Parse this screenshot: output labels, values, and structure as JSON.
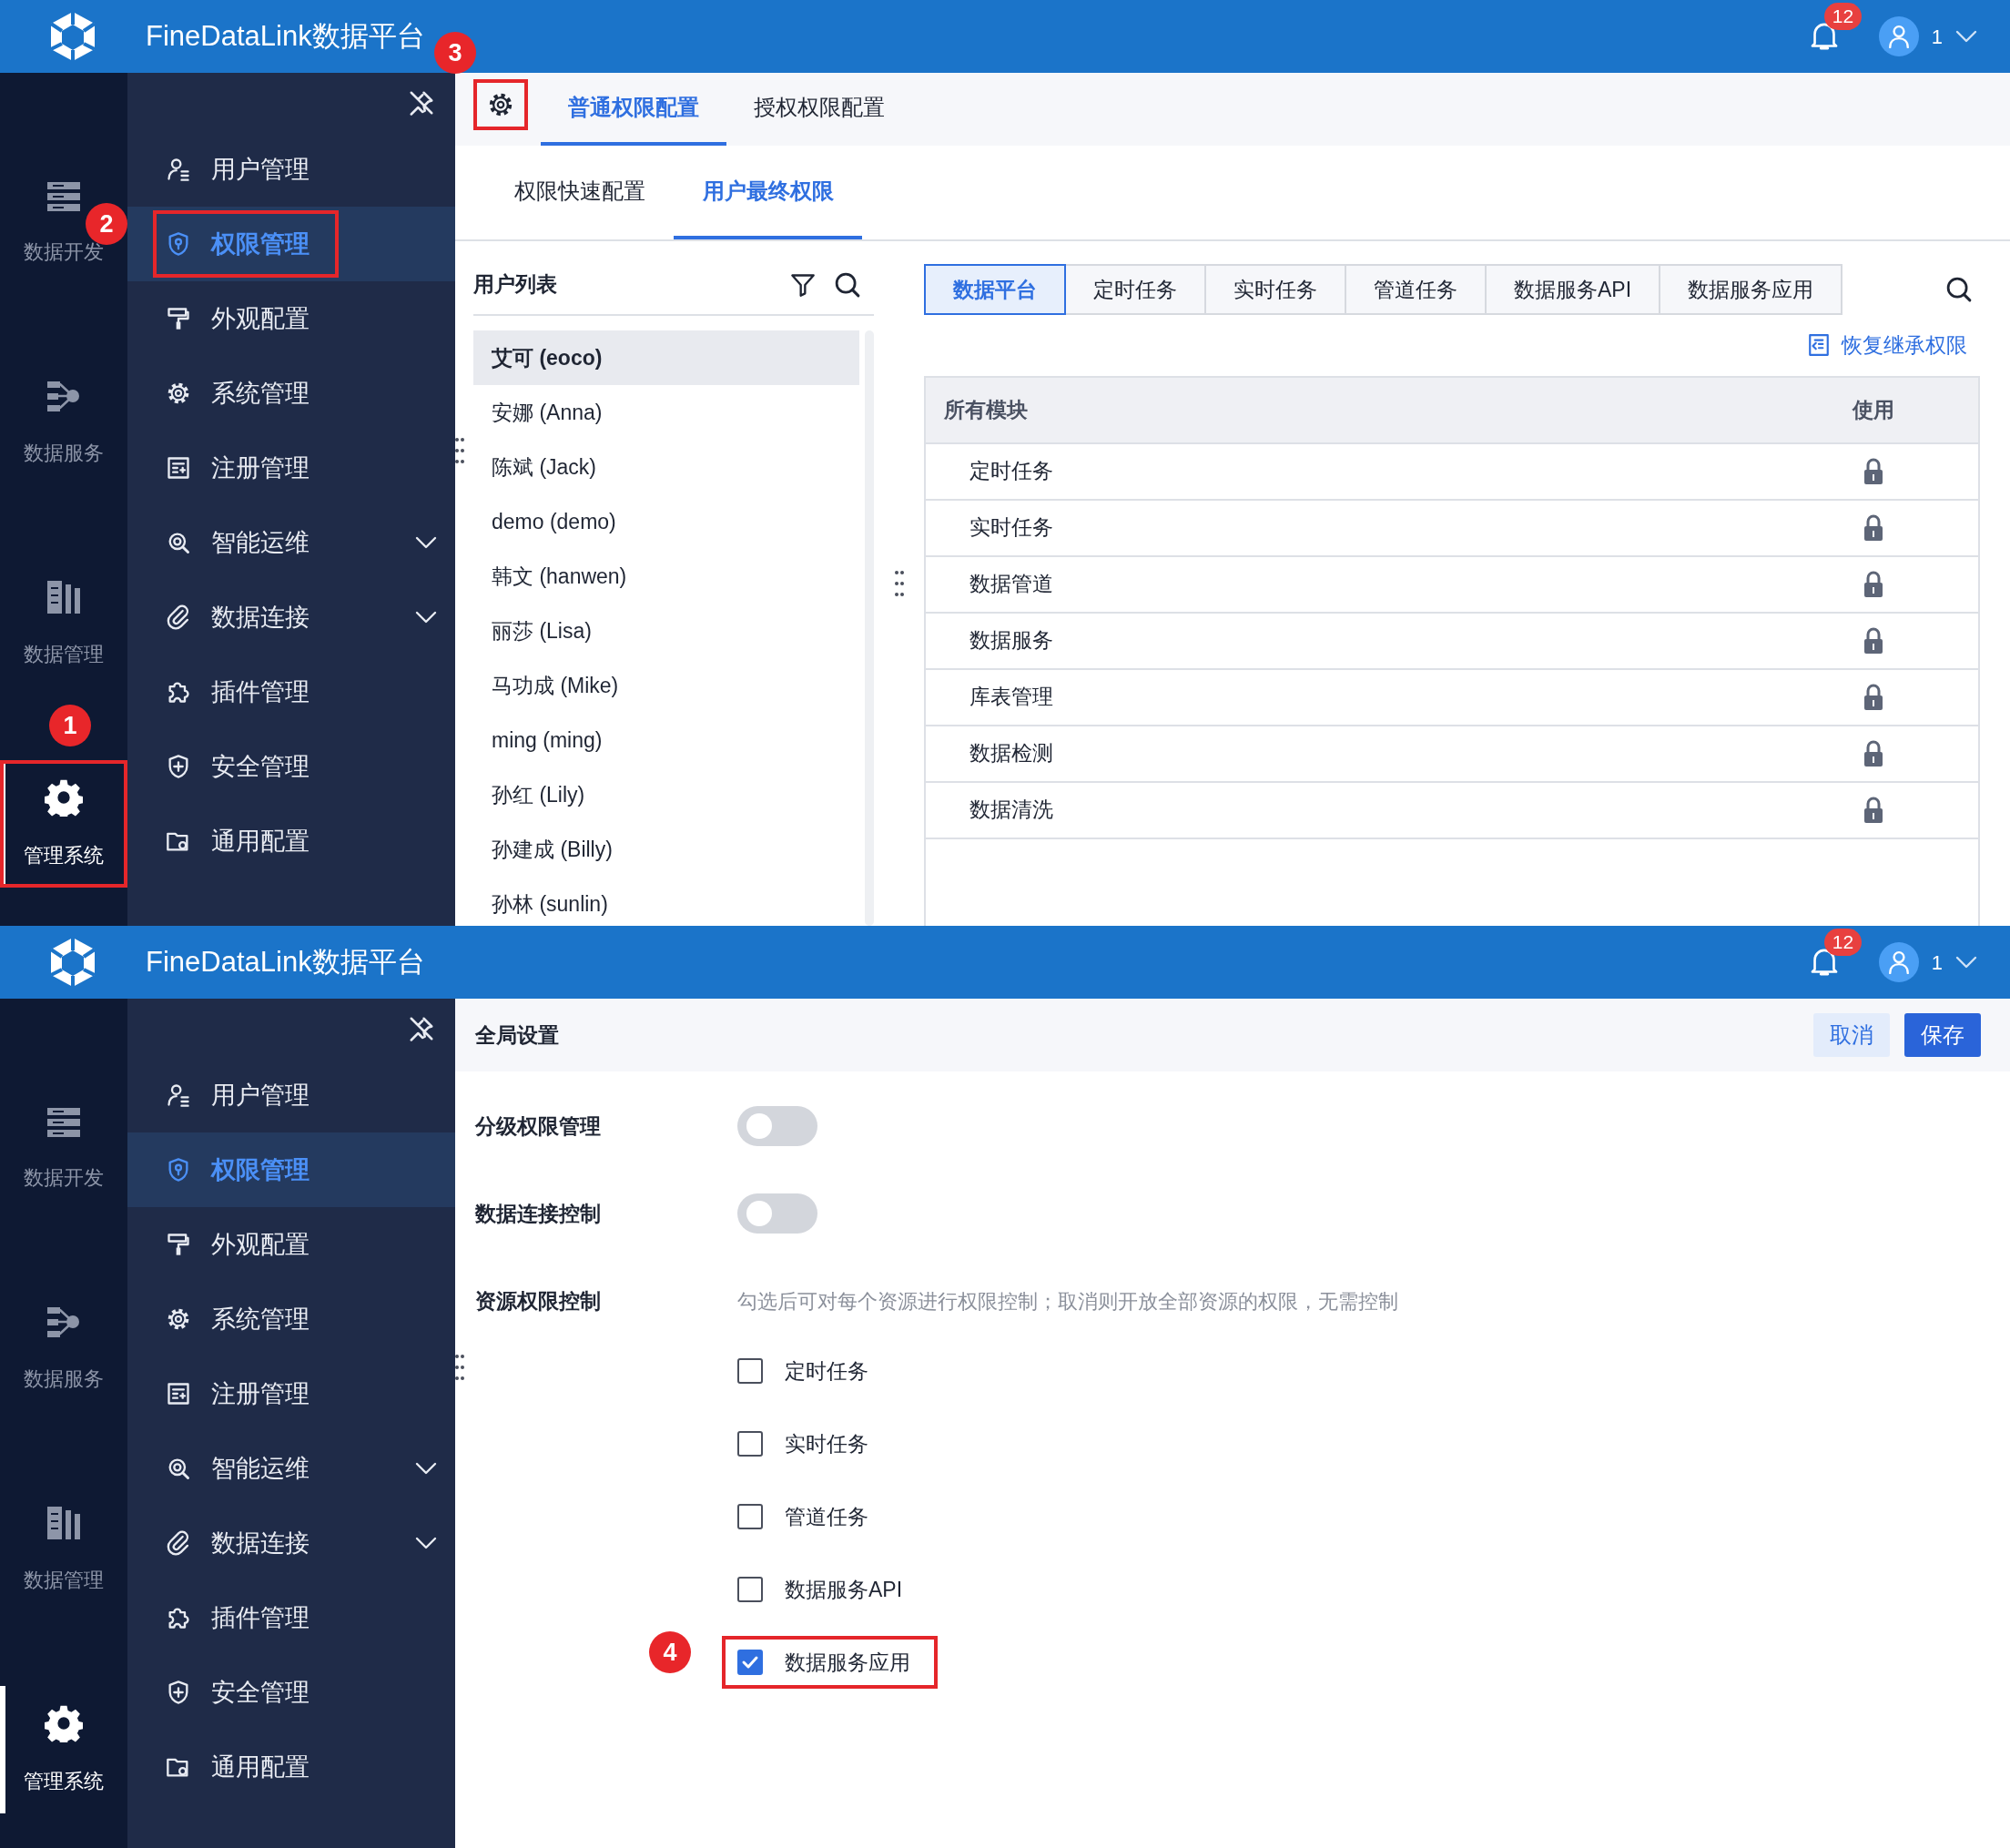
{
  "screens": [
    {
      "header": {
        "title": "FineDataLink数据平台",
        "notifications": "12",
        "user": "1"
      },
      "rail": [
        {
          "label": "数据开发",
          "selected": false,
          "highlighted": false
        },
        {
          "label": "数据服务",
          "selected": false,
          "highlighted": false
        },
        {
          "label": "数据管理",
          "selected": false,
          "highlighted": false
        },
        {
          "label": "管理系统",
          "selected": true,
          "highlighted": true,
          "callout": "1"
        }
      ],
      "menu": [
        {
          "label": "用户管理",
          "kind": "link",
          "selected": false,
          "highlighted": false
        },
        {
          "label": "权限管理",
          "kind": "link",
          "selected": true,
          "highlighted": true,
          "callout": "2"
        },
        {
          "label": "外观配置",
          "kind": "link",
          "selected": false,
          "highlighted": false
        },
        {
          "label": "系统管理",
          "kind": "link",
          "selected": false,
          "highlighted": false
        },
        {
          "label": "注册管理",
          "kind": "link",
          "selected": false,
          "highlighted": false
        },
        {
          "label": "智能运维",
          "kind": "group",
          "selected": false,
          "highlighted": false
        },
        {
          "label": "数据连接",
          "kind": "group",
          "selected": false,
          "highlighted": false
        },
        {
          "label": "插件管理",
          "kind": "link",
          "selected": false,
          "highlighted": false
        },
        {
          "label": "安全管理",
          "kind": "link",
          "selected": false,
          "highlighted": false
        },
        {
          "label": "通用配置",
          "kind": "link",
          "selected": false,
          "highlighted": false
        }
      ],
      "content": {
        "kind": "permissions",
        "settings_button": {
          "highlighted": true,
          "callout": "3"
        },
        "tabs": [
          {
            "label": "普通权限配置",
            "selected": true
          },
          {
            "label": "授权权限配置",
            "selected": false
          }
        ],
        "subtabs": [
          {
            "label": "权限快速配置",
            "selected": false
          },
          {
            "label": "用户最终权限",
            "selected": true
          }
        ],
        "user_list": {
          "title": "用户列表",
          "users": [
            {
              "name": "艾可 (eoco)",
              "selected": true
            },
            {
              "name": "安娜 (Anna)",
              "selected": false
            },
            {
              "name": "陈斌 (Jack)",
              "selected": false
            },
            {
              "name": "demo (demo)",
              "selected": false
            },
            {
              "name": "韩文 (hanwen)",
              "selected": false
            },
            {
              "name": "丽莎 (Lisa)",
              "selected": false
            },
            {
              "name": "马功成 (Mike)",
              "selected": false
            },
            {
              "name": "ming (ming)",
              "selected": false
            },
            {
              "name": "孙红 (Lily)",
              "selected": false
            },
            {
              "name": "孙建成 (Billy)",
              "selected": false
            },
            {
              "name": "孙林 (sunlin)",
              "selected": false
            }
          ]
        },
        "module_tabs": [
          {
            "label": "数据平台",
            "selected": true
          },
          {
            "label": "定时任务",
            "selected": false
          },
          {
            "label": "实时任务",
            "selected": false
          },
          {
            "label": "管道任务",
            "selected": false
          },
          {
            "label": "数据服务API",
            "selected": false
          },
          {
            "label": "数据服务应用",
            "selected": false
          }
        ],
        "restore_link": "恢复继承权限",
        "table": {
          "columns": [
            "所有模块",
            "使用"
          ],
          "rows": [
            {
              "module": "定时任务",
              "locked": true
            },
            {
              "module": "实时任务",
              "locked": true
            },
            {
              "module": "数据管道",
              "locked": true
            },
            {
              "module": "数据服务",
              "locked": true
            },
            {
              "module": "库表管理",
              "locked": true
            },
            {
              "module": "数据检测",
              "locked": true
            },
            {
              "module": "数据清洗",
              "locked": true
            }
          ]
        }
      }
    },
    {
      "header": {
        "title": "FineDataLink数据平台",
        "notifications": "12",
        "user": "1"
      },
      "rail": [
        {
          "label": "数据开发",
          "selected": false,
          "highlighted": false
        },
        {
          "label": "数据服务",
          "selected": false,
          "highlighted": false
        },
        {
          "label": "数据管理",
          "selected": false,
          "highlighted": false
        },
        {
          "label": "管理系统",
          "selected": true,
          "highlighted": false
        }
      ],
      "menu": [
        {
          "label": "用户管理",
          "kind": "link",
          "selected": false,
          "highlighted": false
        },
        {
          "label": "权限管理",
          "kind": "link",
          "selected": true,
          "highlighted": false
        },
        {
          "label": "外观配置",
          "kind": "link",
          "selected": false,
          "highlighted": false
        },
        {
          "label": "系统管理",
          "kind": "link",
          "selected": false,
          "highlighted": false
        },
        {
          "label": "注册管理",
          "kind": "link",
          "selected": false,
          "highlighted": false
        },
        {
          "label": "智能运维",
          "kind": "group",
          "selected": false,
          "highlighted": false
        },
        {
          "label": "数据连接",
          "kind": "group",
          "selected": false,
          "highlighted": false
        },
        {
          "label": "插件管理",
          "kind": "link",
          "selected": false,
          "highlighted": false
        },
        {
          "label": "安全管理",
          "kind": "link",
          "selected": false,
          "highlighted": false
        },
        {
          "label": "通用配置",
          "kind": "link",
          "selected": false,
          "highlighted": false
        }
      ],
      "content": {
        "kind": "global_settings",
        "title": "全局设置",
        "buttons": [
          {
            "label": "取消",
            "kind": "secondary"
          },
          {
            "label": "保存",
            "kind": "primary"
          }
        ],
        "settings": [
          {
            "label": "分级权限管理",
            "kind": "switch",
            "on": false
          },
          {
            "label": "数据连接控制",
            "kind": "switch",
            "on": false
          },
          {
            "label": "资源权限控制",
            "kind": "checklist",
            "hint": "勾选后可对每个资源进行权限控制；取消则开放全部资源的权限，无需控制",
            "options": [
              {
                "label": "定时任务",
                "checked": false,
                "highlighted": false
              },
              {
                "label": "实时任务",
                "checked": false,
                "highlighted": false
              },
              {
                "label": "管道任务",
                "checked": false,
                "highlighted": false
              },
              {
                "label": "数据服务API",
                "checked": false,
                "highlighted": false
              },
              {
                "label": "数据服务应用",
                "checked": true,
                "highlighted": true,
                "callout": "4"
              }
            ]
          }
        ]
      }
    }
  ]
}
